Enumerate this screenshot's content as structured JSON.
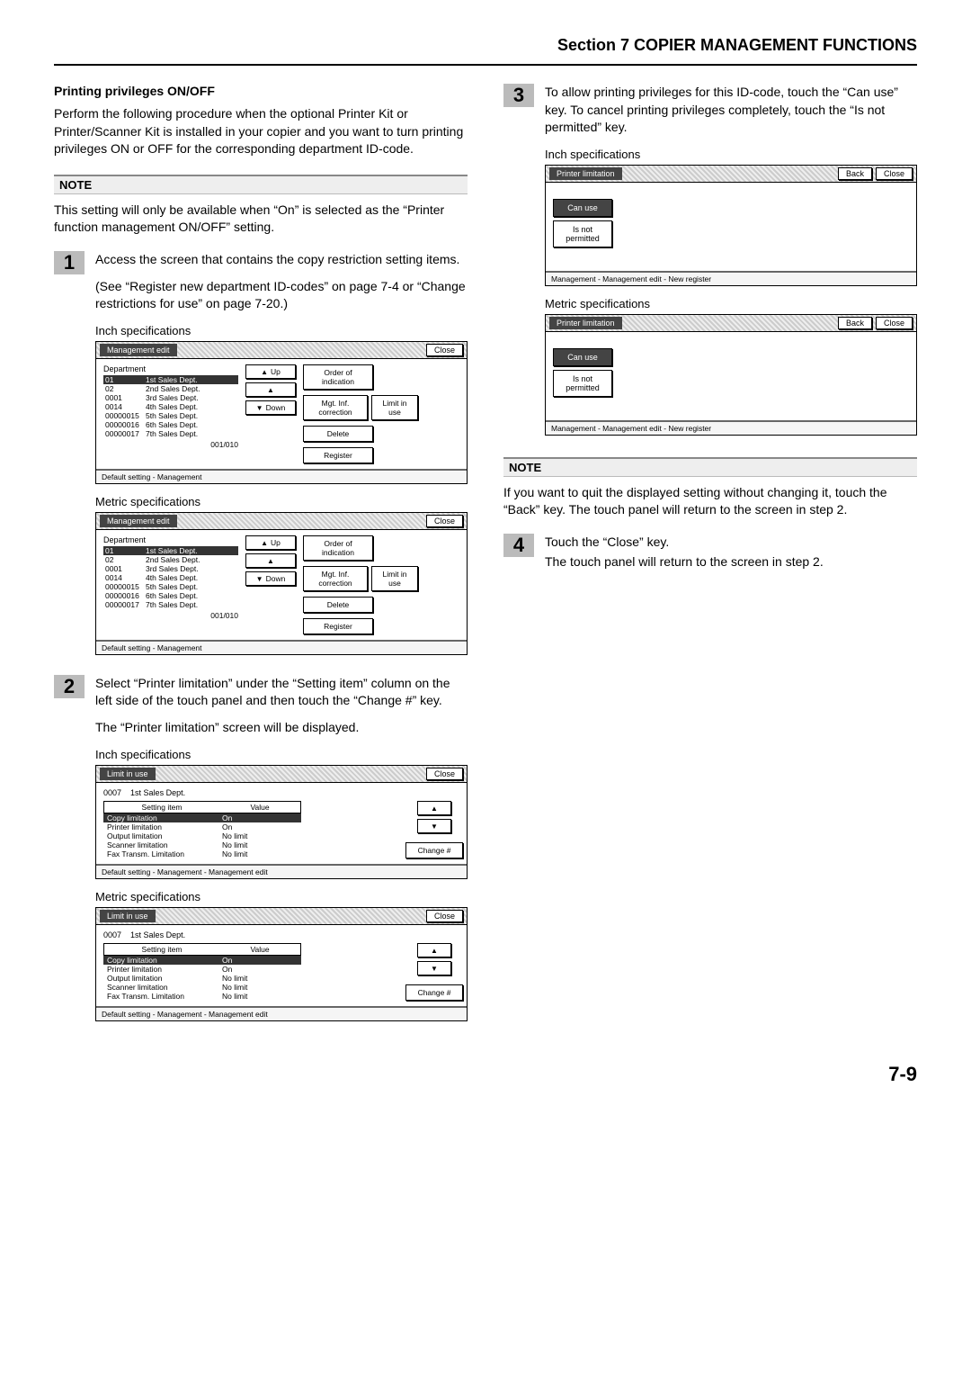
{
  "section_header": "Section 7  COPIER MANAGEMENT FUNCTIONS",
  "page_number": "7-9",
  "left": {
    "heading": "Printing privileges ON/OFF",
    "intro": "Perform the following procedure when the optional Printer Kit or Printer/Scanner Kit is installed in your copier and you want to turn printing privileges ON or OFF for the corresponding department ID-code.",
    "note_label": "NOTE",
    "note_text": "This setting will only be available when “On” is selected as the “Printer function management ON/OFF” setting.",
    "step1_num": "1",
    "step1_text_a": "Access the screen that contains the copy restriction setting items.",
    "step1_text_b": "(See “Register new department ID-codes” on page 7-4 or “Change restrictions for use” on page 7-20.)",
    "caption_inch": "Inch specifications",
    "caption_metric": "Metric specifications",
    "dept_panel": {
      "title": "Management edit",
      "close": "Close",
      "list_header": "Department",
      "rows": [
        {
          "id": "01",
          "name": "1st Sales Dept."
        },
        {
          "id": "02",
          "name": "2nd Sales Dept."
        },
        {
          "id": "0001",
          "name": "3rd Sales Dept."
        },
        {
          "id": "0014",
          "name": "4th Sales Dept."
        },
        {
          "id": "00000015",
          "name": "5th Sales Dept."
        },
        {
          "id": "00000016",
          "name": "6th Sales Dept."
        },
        {
          "id": "00000017",
          "name": "7th Sales Dept."
        }
      ],
      "pager": "001/010",
      "btn_up": "Up",
      "btn_down": "Down",
      "btn_order": "Order of indication",
      "btn_mgt": "Mgt. Inf. correction",
      "btn_limit": "Limit in use",
      "btn_delete": "Delete",
      "btn_register": "Register",
      "breadcrumb": "Default setting - Management"
    },
    "step2_num": "2",
    "step2_text_a": "Select “Printer limitation” under the “Setting item” column on the left side of the touch panel and then touch the “Change #” key.",
    "step2_text_b": "The “Printer limitation” screen will be displayed.",
    "limit_panel": {
      "title": "Limit in use",
      "close": "Close",
      "dept_code": "0007",
      "dept_name": "1st Sales Dept.",
      "col_setting": "Setting item",
      "col_value": "Value",
      "rows": [
        {
          "item": "Copy limitation",
          "value": "On"
        },
        {
          "item": "Printer limitation",
          "value": "On"
        },
        {
          "item": "Output limitation",
          "value": "No limit"
        },
        {
          "item": "Scanner limitation",
          "value": "No limit"
        },
        {
          "item": "Fax Transm. Limitation",
          "value": "No limit"
        }
      ],
      "btn_change": "Change #",
      "breadcrumb": "Default setting - Management - Management edit"
    }
  },
  "right": {
    "step3_num": "3",
    "step3_text": "To allow printing privileges for this ID-code, touch the “Can use” key. To cancel printing privileges completely, touch the “Is not permitted” key.",
    "caption_inch": "Inch specifications",
    "caption_metric": "Metric specifications",
    "pl_panel": {
      "title": "Printer limitation",
      "back": "Back",
      "close": "Close",
      "btn_can_use": "Can use",
      "btn_not_permitted": "Is not permitted",
      "breadcrumb": "Management - Management edit - New register"
    },
    "note_label": "NOTE",
    "note_text": "If you want to quit the displayed setting without changing it, touch the “Back” key. The touch panel will return to the screen in step 2.",
    "step4_num": "4",
    "step4_text_a": "Touch the “Close” key.",
    "step4_text_b": "The touch panel will return to the screen in step 2."
  }
}
